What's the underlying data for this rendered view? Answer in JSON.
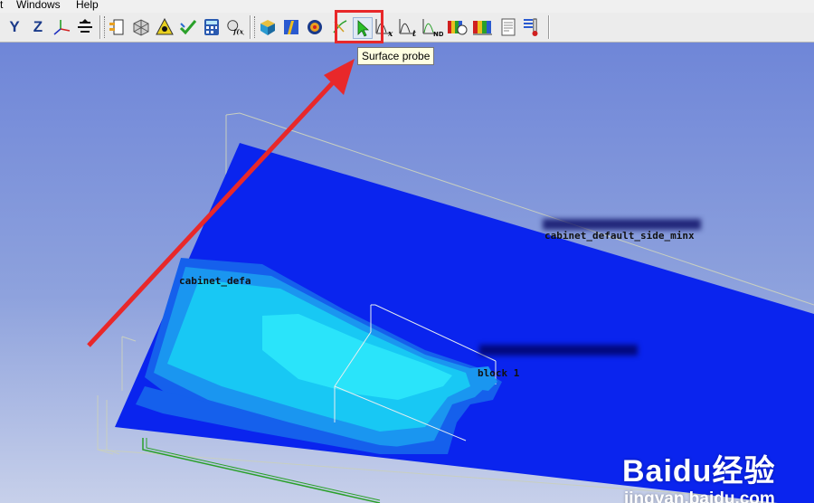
{
  "menu": {
    "partial_item": "t",
    "windows": "Windows",
    "help": "Help"
  },
  "toolbar": {
    "y_view_label": "Y",
    "z_view_label": "Z",
    "highlighted_tool": "surface-probe-icon"
  },
  "tooltip": {
    "text": "Surface probe"
  },
  "viewport": {
    "labels": {
      "cabinet_top": "cabinet_default_side_minx",
      "cabinet_left": "cabinet_defa",
      "block": "block 1"
    }
  },
  "annotation": {
    "arrow_color": "#e8282a",
    "box_color": "#e8282a"
  },
  "watermark": {
    "brand": "Baidu经验",
    "url": "jingyan.baidu.com"
  },
  "colors": {
    "background": "#7f93d8",
    "deep_blue": "#0a24ee",
    "mid_blue": "#1a68ee",
    "light_cyan": "#18c8f4",
    "bright_cyan": "#2ae4fa"
  }
}
